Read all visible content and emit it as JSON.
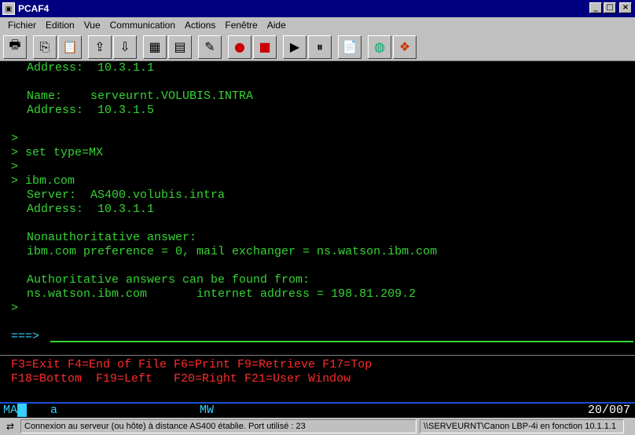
{
  "window": {
    "title": "PCAF4"
  },
  "menu": [
    {
      "label": "Fichier"
    },
    {
      "label": "Edition"
    },
    {
      "label": "Vue"
    },
    {
      "label": "Communication"
    },
    {
      "label": "Actions"
    },
    {
      "label": "Fenêtre"
    },
    {
      "label": "Aide"
    }
  ],
  "toolbar": {
    "buttons": [
      {
        "icon": "print-icon"
      },
      {
        "icon": "copy-icon"
      },
      {
        "icon": "paste-icon"
      },
      {
        "icon": "send-icon"
      },
      {
        "icon": "receive-icon"
      },
      {
        "icon": "keypad-icon"
      },
      {
        "icon": "screen-grid-icon"
      },
      {
        "icon": "edit-icon"
      },
      {
        "icon": "macro-record-icon"
      },
      {
        "icon": "macro-stop-icon"
      },
      {
        "icon": "macro-play-icon"
      },
      {
        "icon": "macro-pause-icon"
      },
      {
        "icon": "clipboard-icon"
      },
      {
        "icon": "globe-icon"
      },
      {
        "icon": "book-icon"
      }
    ]
  },
  "terminal": {
    "lines": [
      "Address:  10.3.1.1",
      "",
      "Name:    serveurnt.VOLUBIS.INTRA",
      "Address:  10.3.1.5",
      "",
      ">",
      "> set type=MX",
      ">",
      "> ibm.com",
      "Server:  AS400.volubis.intra",
      "Address:  10.3.1.1",
      "",
      "Nonauthoritative answer:",
      "ibm.com preference = 0, mail exchanger = ns.watson.ibm.com",
      "",
      "Authoritative answers can be found from:",
      "ns.watson.ibm.com       internet address = 198.81.209.2",
      ">"
    ],
    "prompt": "===>",
    "fkeys_line1": "F3=Exit F4=End of File F6=Print F9=Retrieve F17=Top",
    "fkeys_line2": "F18=Bottom  F19=Left   F20=Right F21=User Window"
  },
  "oia": {
    "mode": "MA",
    "field": "a",
    "indicator": "MW",
    "position": "20/007"
  },
  "status": {
    "connection": "Connexion au serveur (ou hôte) à distance AS400 établie. Port utilisé : 23",
    "printer": "\\\\SERVEURNT\\Canon LBP-4i en fonction 10.1.1.1"
  }
}
